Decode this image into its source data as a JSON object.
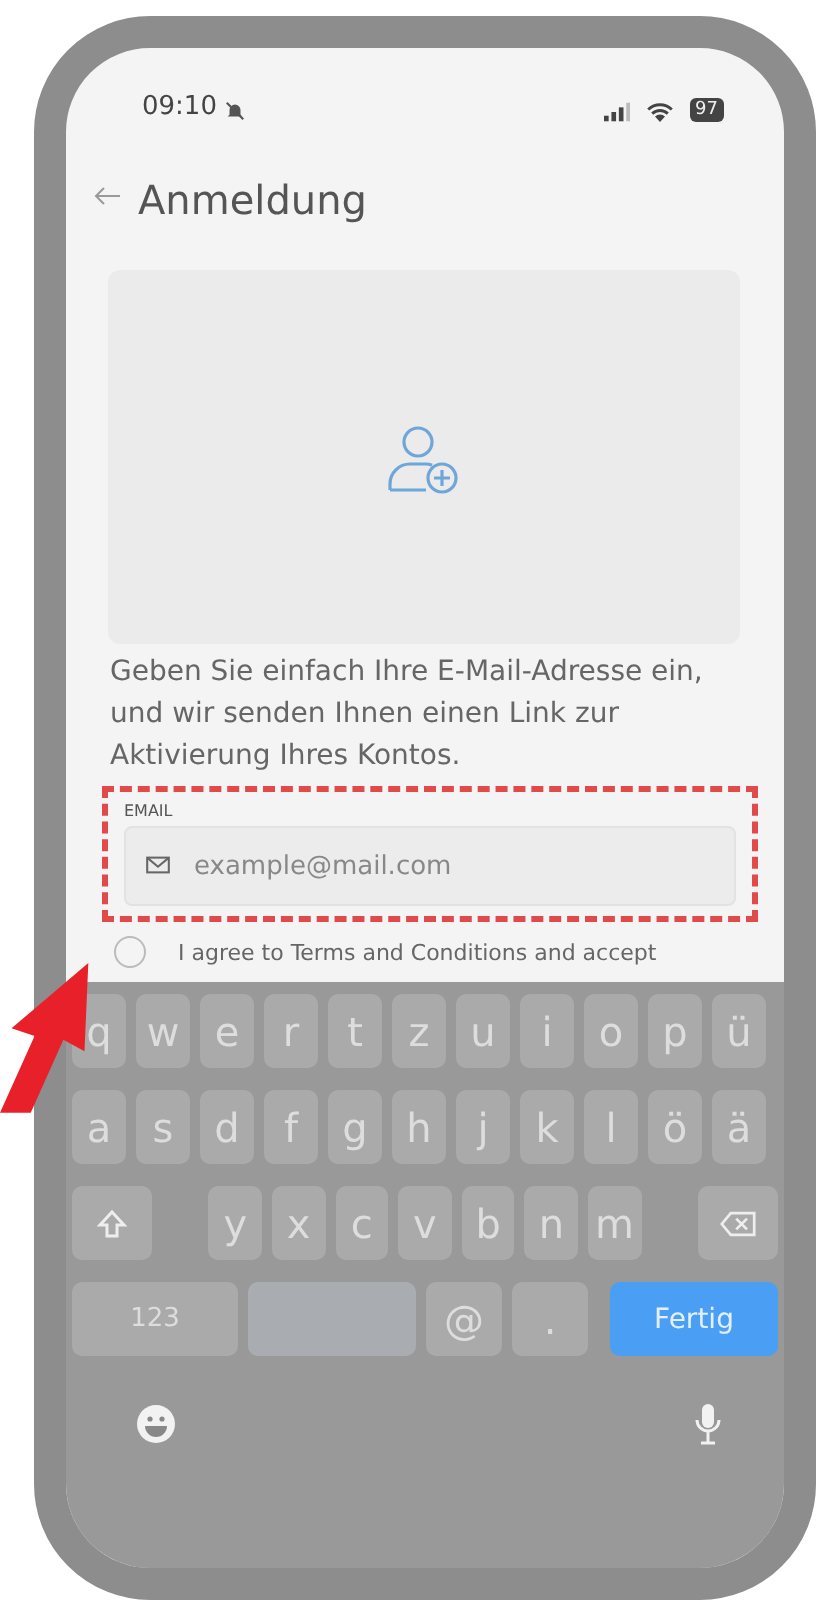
{
  "status_bar": {
    "time": "09:10",
    "battery": "97"
  },
  "header": {
    "title": "Anmeldung"
  },
  "intro": "Geben Sie einfach Ihre E-Mail-Adresse ein, und wir senden Ihnen einen Link zur Aktivierung Ihres Kontos.",
  "email": {
    "label": "EMAIL",
    "placeholder": "example@mail.com"
  },
  "terms": {
    "text": "I agree to Terms and Conditions and accept",
    "checked": false
  },
  "keyboard": {
    "rows": [
      [
        {
          "kind": "letter",
          "label": "q"
        },
        {
          "kind": "letter",
          "label": "w"
        },
        {
          "kind": "letter",
          "label": "e"
        },
        {
          "kind": "letter",
          "label": "r"
        },
        {
          "kind": "letter",
          "label": "t"
        },
        {
          "kind": "letter",
          "label": "z"
        },
        {
          "kind": "letter",
          "label": "u"
        },
        {
          "kind": "letter",
          "label": "i"
        },
        {
          "kind": "letter",
          "label": "o"
        },
        {
          "kind": "letter",
          "label": "p"
        },
        {
          "kind": "letter",
          "label": "ü"
        }
      ],
      [
        {
          "kind": "letter",
          "label": "a"
        },
        {
          "kind": "letter",
          "label": "s"
        },
        {
          "kind": "letter",
          "label": "d"
        },
        {
          "kind": "letter",
          "label": "f"
        },
        {
          "kind": "letter",
          "label": "g"
        },
        {
          "kind": "letter",
          "label": "h"
        },
        {
          "kind": "letter",
          "label": "j"
        },
        {
          "kind": "letter",
          "label": "k"
        },
        {
          "kind": "letter",
          "label": "l"
        },
        {
          "kind": "letter",
          "label": "ö"
        },
        {
          "kind": "letter",
          "label": "ä"
        }
      ],
      [
        {
          "kind": "shift"
        },
        {
          "kind": "gap"
        },
        {
          "kind": "letter",
          "label": "y"
        },
        {
          "kind": "letter",
          "label": "x"
        },
        {
          "kind": "letter",
          "label": "c"
        },
        {
          "kind": "letter",
          "label": "v"
        },
        {
          "kind": "letter",
          "label": "b"
        },
        {
          "kind": "letter",
          "label": "n"
        },
        {
          "kind": "letter",
          "label": "m"
        },
        {
          "kind": "gap"
        },
        {
          "kind": "backspace"
        }
      ]
    ],
    "bottom_row": [
      {
        "kind": "mode",
        "label": "123"
      },
      {
        "kind": "space"
      },
      {
        "kind": "symbol",
        "label": "@"
      },
      {
        "kind": "symbol",
        "label": "."
      },
      {
        "kind": "done",
        "label": "Fertig"
      }
    ]
  }
}
